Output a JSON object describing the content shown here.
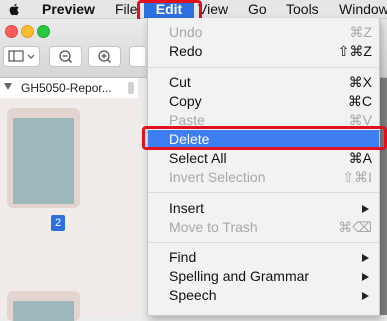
{
  "menubar": {
    "app_name": "Preview",
    "items": [
      "File",
      "Edit",
      "View",
      "Go",
      "Tools",
      "Window"
    ]
  },
  "sidebar": {
    "doc_title": "GH5050-Repor...",
    "page_badge": "2"
  },
  "edit_menu": {
    "groups": [
      [
        {
          "label": "Undo",
          "shortcut": "⌘Z",
          "enabled": false
        },
        {
          "label": "Redo",
          "shortcut": "⇧⌘Z",
          "enabled": true
        }
      ],
      [
        {
          "label": "Cut",
          "shortcut": "⌘X",
          "enabled": true
        },
        {
          "label": "Copy",
          "shortcut": "⌘C",
          "enabled": true
        },
        {
          "label": "Paste",
          "shortcut": "⌘V",
          "enabled": false
        },
        {
          "label": "Delete",
          "shortcut": "",
          "enabled": true,
          "highlighted": true
        },
        {
          "label": "Select All",
          "shortcut": "⌘A",
          "enabled": true
        },
        {
          "label": "Invert Selection",
          "shortcut": "⇧⌘I",
          "enabled": false
        }
      ],
      [
        {
          "label": "Insert",
          "submenu": true,
          "enabled": true
        },
        {
          "label": "Move to Trash",
          "shortcut": "⌘⌫",
          "enabled": false
        }
      ],
      [
        {
          "label": "Find",
          "submenu": true,
          "enabled": true
        },
        {
          "label": "Spelling and Grammar",
          "submenu": true,
          "enabled": true
        },
        {
          "label": "Speech",
          "submenu": true,
          "enabled": true
        }
      ]
    ]
  },
  "colors": {
    "highlight": "#3f7ef0",
    "annotation_red": "#e0101e",
    "thumbnail": "#9db8ba"
  }
}
